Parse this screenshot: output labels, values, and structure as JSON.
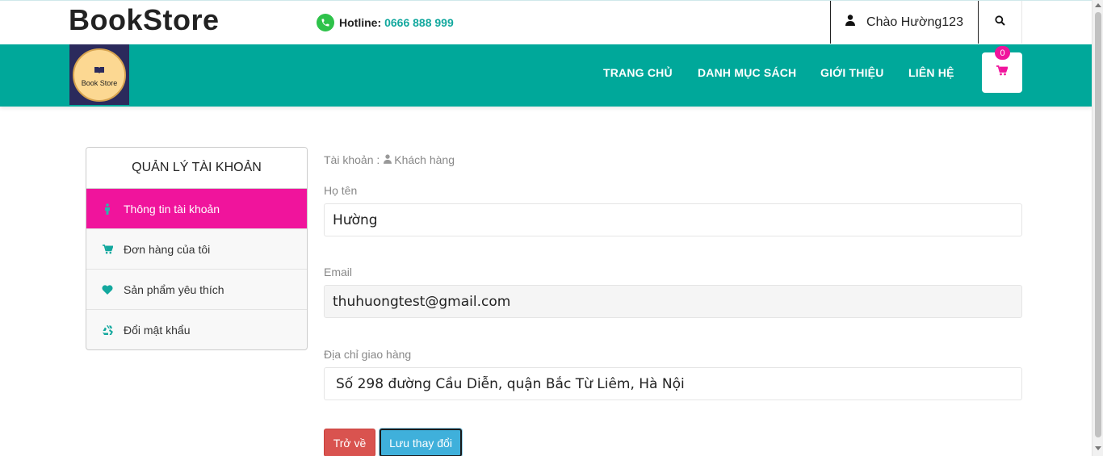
{
  "header": {
    "logo_text": "BookStore",
    "hotline_label": "Hotline:",
    "hotline_number": "0666 888 999",
    "greeting": "Chào Hường123"
  },
  "nav": {
    "brand_label": "Book Store",
    "links": [
      "TRANG CHỦ",
      "DANH MỤC SÁCH",
      "GIỚI THIỆU",
      "LIÊN HỆ"
    ],
    "cart_count": "0"
  },
  "sidebar": {
    "title": "QUẢN LÝ TÀI KHOẢN",
    "items": [
      {
        "label": "Thông tin tài khoản",
        "icon": "person-icon",
        "active": true
      },
      {
        "label": "Đơn hàng của tôi",
        "icon": "cart-icon",
        "active": false
      },
      {
        "label": "Sản phẩm yêu thích",
        "icon": "heart-icon",
        "active": false
      },
      {
        "label": "Đổi mật khẩu",
        "icon": "recycle-icon",
        "active": false
      }
    ]
  },
  "breadcrumb": {
    "prefix": "Tài khoản :",
    "current": "Khách hàng"
  },
  "form": {
    "name_label": "Họ tên",
    "name_value": "Hường",
    "email_label": "Email",
    "email_value": "thuhuongtest@gmail.com",
    "address_label": "Địa chỉ giao hàng",
    "address_value": "Số 298 đường Cầu Diễn, quận Bắc Từ Liêm, Hà Nội",
    "back_label": "Trở về",
    "save_label": "Lưu thay đổi"
  },
  "colors": {
    "nav_bg": "#00a89a",
    "accent_pink": "#f0149c",
    "hotline_teal": "#13a89e",
    "back_red": "#d9534f",
    "save_blue": "#3fb0db"
  }
}
